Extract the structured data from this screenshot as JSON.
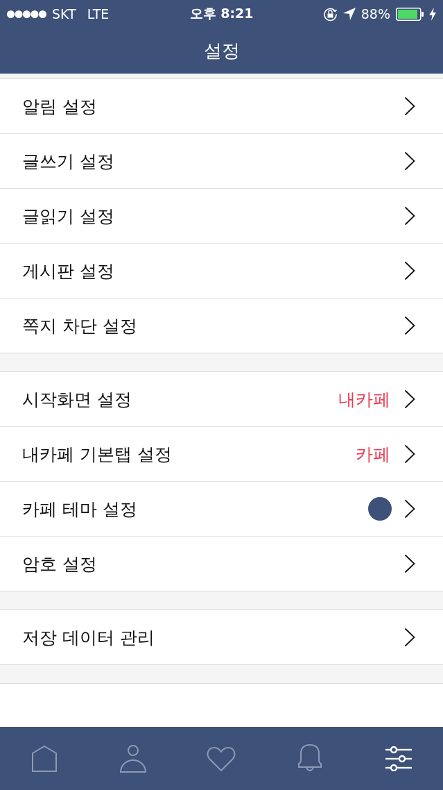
{
  "status_bar": {
    "carrier": "SKT",
    "network": "LTE",
    "time": "오후 8:21",
    "battery": "88%"
  },
  "header": {
    "title": "설정"
  },
  "sections": [
    {
      "rows": [
        {
          "kind": "plain",
          "label": "알림 설정"
        },
        {
          "kind": "plain",
          "label": "글쓰기 설정"
        },
        {
          "kind": "plain",
          "label": "글읽기 설정"
        },
        {
          "kind": "plain",
          "label": "게시판 설정"
        },
        {
          "kind": "plain",
          "label": "쪽지 차단 설정"
        }
      ]
    },
    {
      "rows": [
        {
          "kind": "value",
          "label": "시작화면 설정",
          "value": "내카페"
        },
        {
          "kind": "value",
          "label": "내카페 기본탭 설정",
          "value": "카페"
        },
        {
          "kind": "swatch",
          "label": "카페 테마 설정",
          "color": "#3d5179"
        },
        {
          "kind": "plain",
          "label": "암호 설정"
        }
      ]
    },
    {
      "rows": [
        {
          "kind": "plain",
          "label": "저장 데이터 관리"
        }
      ]
    }
  ],
  "tab_bar": {
    "tabs": [
      {
        "kind": "home",
        "selected": false
      },
      {
        "kind": "person",
        "selected": false
      },
      {
        "kind": "heart",
        "selected": false
      },
      {
        "kind": "bell",
        "selected": false
      },
      {
        "kind": "sliders",
        "selected": true
      }
    ]
  }
}
